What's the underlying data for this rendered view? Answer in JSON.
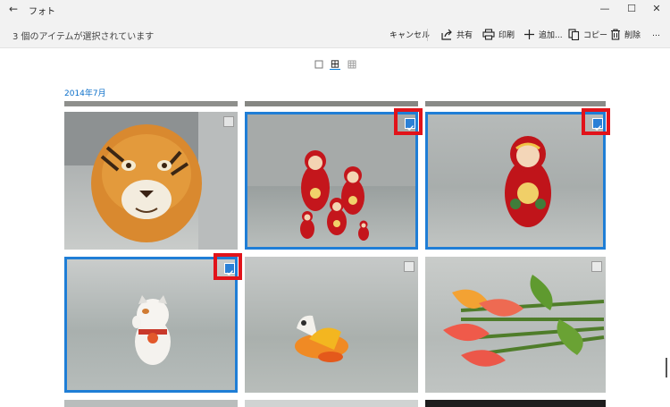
{
  "titlebar": {
    "app_title": "フォト",
    "back_glyph": "←",
    "minimize_glyph": "—",
    "maximize_glyph": "☐",
    "close_glyph": "✕"
  },
  "commandbar": {
    "selection_text": "3 個のアイテムが選択されています",
    "cancel_label": "キャンセル",
    "share_label": "共有",
    "print_label": "印刷",
    "add_label": "追加...",
    "copy_label": "コピー",
    "delete_label": "削除",
    "more_label": "…"
  },
  "gallery": {
    "date_heading": "2014年7月",
    "photos": [
      {
        "subject": "tiger",
        "selected": false
      },
      {
        "subject": "matryoshka-group",
        "selected": true
      },
      {
        "subject": "matryoshka-single",
        "selected": true
      },
      {
        "subject": "maneki-neko",
        "selected": true
      },
      {
        "subject": "toy-horse",
        "selected": false
      },
      {
        "subject": "tulips",
        "selected": false
      }
    ]
  },
  "colors": {
    "accent": "#1f7ed6",
    "highlight_red": "#e1131a",
    "heading_blue": "#0b6fc9"
  }
}
